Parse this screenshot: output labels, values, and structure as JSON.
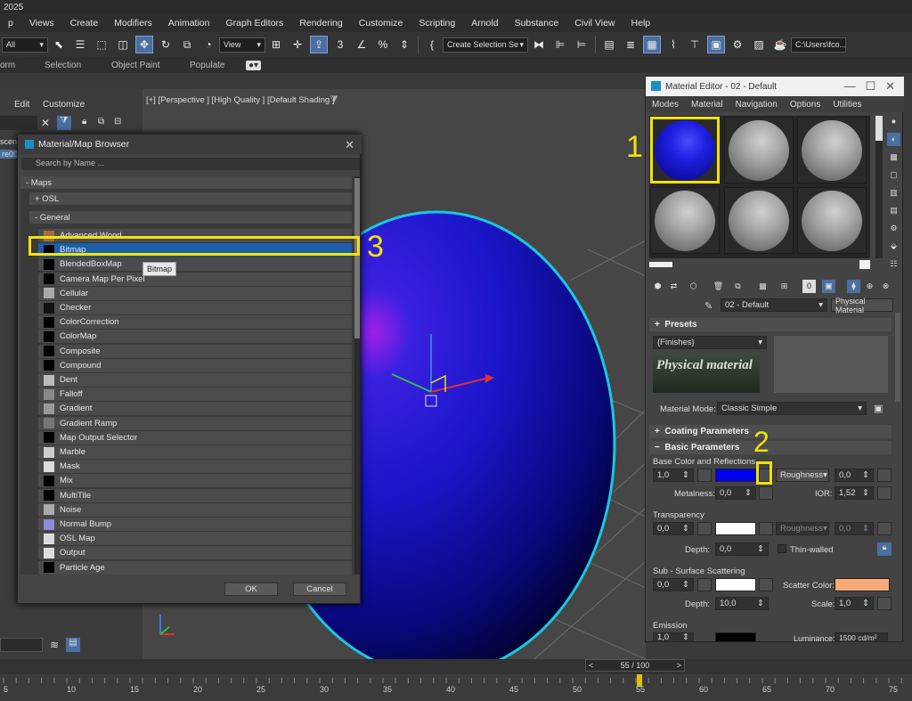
{
  "app": {
    "title": "2025"
  },
  "menu": [
    "p",
    "Views",
    "Create",
    "Modifiers",
    "Animation",
    "Graph Editors",
    "Rendering",
    "Customize",
    "Scripting",
    "Arnold",
    "Substance",
    "Civil View",
    "Help"
  ],
  "toolbar": {
    "filter_value": "All",
    "view_value": "View",
    "selection_set_placeholder": "Create Selection Se",
    "path_value": "C:\\Users\\fco..."
  },
  "ribbon": {
    "items": [
      "orm",
      "Selection",
      "Object Paint",
      "Populate"
    ]
  },
  "left_panel": {
    "menu_edit": "Edit",
    "menu_customize": "Customize",
    "trunc1": "scen",
    "trunc2": "re00"
  },
  "viewport": {
    "label": "[+] [Perspective ] [High Quality ] [Default Shading ]"
  },
  "timeline": {
    "frame_display": "55 / 100",
    "ticks": [
      "5",
      "10",
      "15",
      "20",
      "25",
      "30",
      "35",
      "40",
      "45",
      "50",
      "55",
      "60",
      "65",
      "70",
      "75"
    ]
  },
  "browser": {
    "title": "Material/Map Browser",
    "search_placeholder": "Search by Name ...",
    "group_maps": "- Maps",
    "group_osl": "+ OSL",
    "group_general": "- General",
    "items": [
      {
        "label": "Advanced Wood",
        "swatch": "#a86a3a"
      },
      {
        "label": "Bitmap",
        "swatch": "#000000"
      },
      {
        "label": "BlendedBoxMap",
        "swatch": "#000000"
      },
      {
        "label": "Camera Map Per Pixel",
        "swatch": "#000000"
      },
      {
        "label": "Cellular",
        "swatch": "#aaaaaa"
      },
      {
        "label": "Checker",
        "swatch": "#111111"
      },
      {
        "label": "ColorCorrection",
        "swatch": "#000000"
      },
      {
        "label": "ColorMap",
        "swatch": "#000000"
      },
      {
        "label": "Composite",
        "swatch": "#000000"
      },
      {
        "label": "Compound",
        "swatch": "#000000"
      },
      {
        "label": "Dent",
        "swatch": "#bbbbbb"
      },
      {
        "label": "Falloff",
        "swatch": "#888888"
      },
      {
        "label": "Gradient",
        "swatch": "#999999"
      },
      {
        "label": "Gradient Ramp",
        "swatch": "#777777"
      },
      {
        "label": "Map Output Selector",
        "swatch": "#000000"
      },
      {
        "label": "Marble",
        "swatch": "#cccccc"
      },
      {
        "label": "Mask",
        "swatch": "#dddddd"
      },
      {
        "label": "Mix",
        "swatch": "#000000"
      },
      {
        "label": "MultiTile",
        "swatch": "#000000"
      },
      {
        "label": "Noise",
        "swatch": "#aaaaaa"
      },
      {
        "label": "Normal Bump",
        "swatch": "#8c8cd8"
      },
      {
        "label": "OSL Map",
        "swatch": "#dddddd"
      },
      {
        "label": "Output",
        "swatch": "#dddddd"
      },
      {
        "label": "Particle Age",
        "swatch": "#000000"
      }
    ],
    "tooltip": "Bitmap",
    "ok": "OK",
    "cancel": "Cancel"
  },
  "annotations": {
    "one": "1",
    "two": "2",
    "three": "3"
  },
  "editor": {
    "title": "Material Editor - 02 - Default",
    "menu": [
      "Modes",
      "Material",
      "Navigation",
      "Options",
      "Utilities"
    ],
    "material_name": "02 - Default",
    "material_type": "Physical Material",
    "presets_header": "Presets",
    "finishes": "{Finishes}",
    "logo_text": "Physical material",
    "mode_label": "Material Mode:",
    "mode_value": "Classic Simple",
    "coating_header": "Coating Parameters",
    "basic_header": "Basic Parameters",
    "base_section": "Base Color and Reflections",
    "base_weight": "1,0",
    "roughness_label": "Roughness",
    "roughness_value": "0,0",
    "metalness_label": "Metalness:",
    "metalness_value": "0,0",
    "ior_label": "IOR:",
    "ior_value": "1,52",
    "transparency_section": "Transparency",
    "transparency_value": "0,0",
    "transp_roughness_label": "Roughness",
    "transp_roughness_value": "0,0",
    "depth_label": "Depth:",
    "depth_value": "0,0",
    "thin_walled": "Thin-walled",
    "sss_section": "Sub - Surface Scattering",
    "sss_value": "0,0",
    "scatter_label": "Scatter Color:",
    "sss_depth_value": "10,0",
    "scale_label": "Scale:",
    "scale_value": "1,0",
    "emission_section": "Emission",
    "emission_value": "1,0",
    "luminance_label": "Luminance:",
    "luminance_value": "1500 cd/m²",
    "colors": {
      "base": "#0000ee",
      "transparency": "#ffffff",
      "sss": "#ffffff",
      "scatter": "#f9a878",
      "emission": "#000000"
    }
  }
}
